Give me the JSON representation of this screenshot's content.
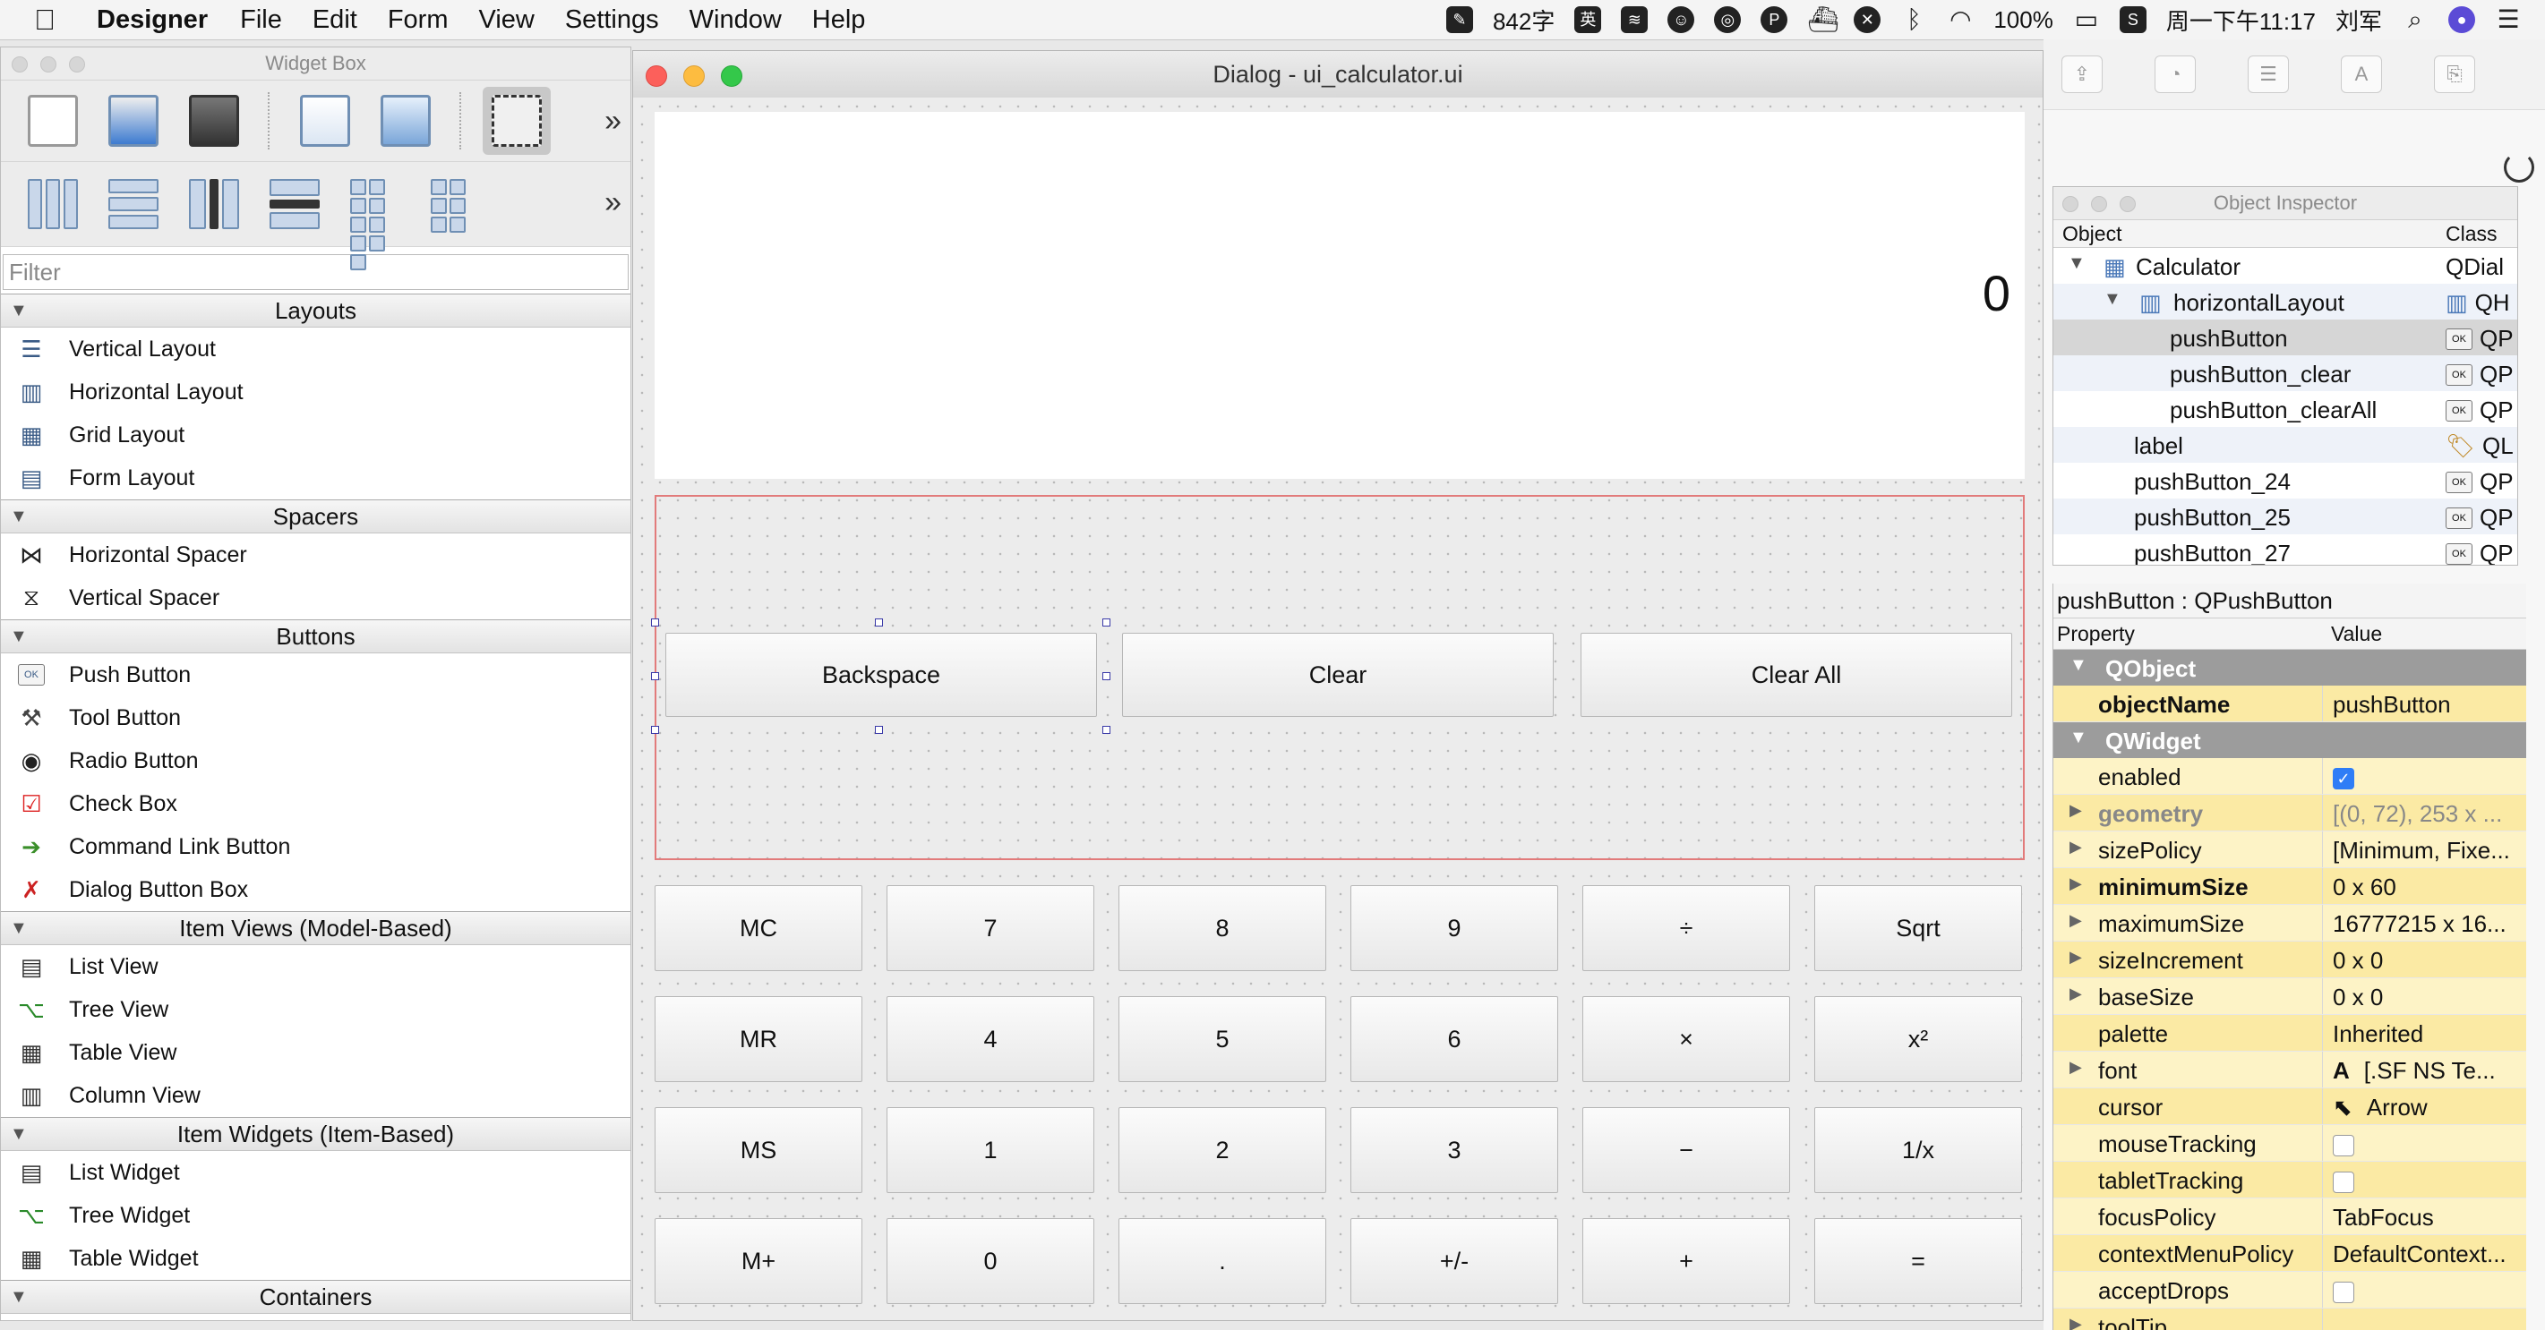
{
  "menubar": {
    "app_name": "Designer",
    "menus": [
      "File",
      "Edit",
      "Form",
      "View",
      "Settings",
      "Window",
      "Help"
    ],
    "word_count": "842字",
    "ime": "英",
    "battery": "100%",
    "clock": "周一下午11:17",
    "user": "刘军"
  },
  "widget_box": {
    "title": "Widget Box",
    "filter_placeholder": "Filter",
    "categories": [
      {
        "name": "Layouts",
        "items": [
          "Vertical Layout",
          "Horizontal Layout",
          "Grid Layout",
          "Form Layout"
        ]
      },
      {
        "name": "Spacers",
        "items": [
          "Horizontal Spacer",
          "Vertical Spacer"
        ]
      },
      {
        "name": "Buttons",
        "items": [
          "Push Button",
          "Tool Button",
          "Radio Button",
          "Check Box",
          "Command Link Button",
          "Dialog Button Box"
        ]
      },
      {
        "name": "Item Views (Model-Based)",
        "items": [
          "List View",
          "Tree View",
          "Table View",
          "Column View"
        ]
      },
      {
        "name": "Item Widgets (Item-Based)",
        "items": [
          "List Widget",
          "Tree Widget",
          "Table Widget"
        ]
      },
      {
        "name": "Containers",
        "items": []
      }
    ]
  },
  "dialog": {
    "title": "Dialog - ui_calculator.ui",
    "display_value": "0",
    "top_buttons": [
      "Backspace",
      "Clear",
      "Clear All"
    ],
    "keypad": [
      [
        "MC",
        "7",
        "8",
        "9",
        "÷",
        "Sqrt"
      ],
      [
        "MR",
        "4",
        "5",
        "6",
        "×",
        "x²"
      ],
      [
        "MS",
        "1",
        "2",
        "3",
        "−",
        "1/x"
      ],
      [
        "M+",
        "0",
        ".",
        "+/-",
        "+",
        "="
      ]
    ]
  },
  "object_inspector": {
    "title": "Object Inspector",
    "col_object": "Object",
    "col_class": "Class",
    "rows": [
      {
        "name": "Calculator",
        "class": "QDial",
        "level": 0,
        "expanded": true
      },
      {
        "name": "horizontalLayout",
        "class": "QH",
        "level": 1,
        "expanded": true
      },
      {
        "name": "pushButton",
        "class": "QP",
        "level": 2,
        "selected": true
      },
      {
        "name": "pushButton_clear",
        "class": "QP",
        "level": 2
      },
      {
        "name": "pushButton_clearAll",
        "class": "QP",
        "level": 2
      },
      {
        "name": "label",
        "class": "QL",
        "level": 1
      },
      {
        "name": "pushButton_24",
        "class": "QP",
        "level": 1
      },
      {
        "name": "pushButton_25",
        "class": "QP",
        "level": 1
      },
      {
        "name": "pushButton_27",
        "class": "QP",
        "level": 1
      }
    ]
  },
  "property_editor": {
    "object_label": "pushButton : QPushButton",
    "col_property": "Property",
    "col_value": "Value",
    "groups": [
      {
        "name": "QObject",
        "rows": [
          {
            "prop": "objectName",
            "value": "pushButton",
            "bold": true
          }
        ]
      },
      {
        "name": "QWidget",
        "rows": [
          {
            "prop": "enabled",
            "value": "",
            "checkbox": "on"
          },
          {
            "prop": "geometry",
            "value": "[(0, 72), 253 x ...",
            "grey": true,
            "expand": true
          },
          {
            "prop": "sizePolicy",
            "value": "[Minimum, Fixe...",
            "expand": true
          },
          {
            "prop": "minimumSize",
            "value": "0 x 60",
            "bold": true,
            "expand": true
          },
          {
            "prop": "maximumSize",
            "value": "16777215 x 16...",
            "expand": true
          },
          {
            "prop": "sizeIncrement",
            "value": "0 x 0",
            "expand": true
          },
          {
            "prop": "baseSize",
            "value": "0 x 0",
            "expand": true
          },
          {
            "prop": "palette",
            "value": "Inherited"
          },
          {
            "prop": "font",
            "value": "[.SF NS Te...",
            "expand": true,
            "icon": "A"
          },
          {
            "prop": "cursor",
            "value": "Arrow",
            "icon": "arrow-cursor"
          },
          {
            "prop": "mouseTracking",
            "value": "",
            "checkbox": "off"
          },
          {
            "prop": "tabletTracking",
            "value": "",
            "checkbox": "off"
          },
          {
            "prop": "focusPolicy",
            "value": "TabFocus"
          },
          {
            "prop": "contextMenuPolicy",
            "value": "DefaultContext..."
          },
          {
            "prop": "acceptDrops",
            "value": "",
            "checkbox": "off"
          },
          {
            "prop": "toolTip",
            "value": "",
            "expand": true
          }
        ]
      }
    ]
  },
  "colors": {
    "traffic_red": "#fc605b",
    "traffic_yellow": "#fdbc40",
    "traffic_green": "#34c84a",
    "layout_border": "#e27b7b",
    "property_yellow": "#fdf3c6",
    "group_grey": "#9c9c9c"
  }
}
